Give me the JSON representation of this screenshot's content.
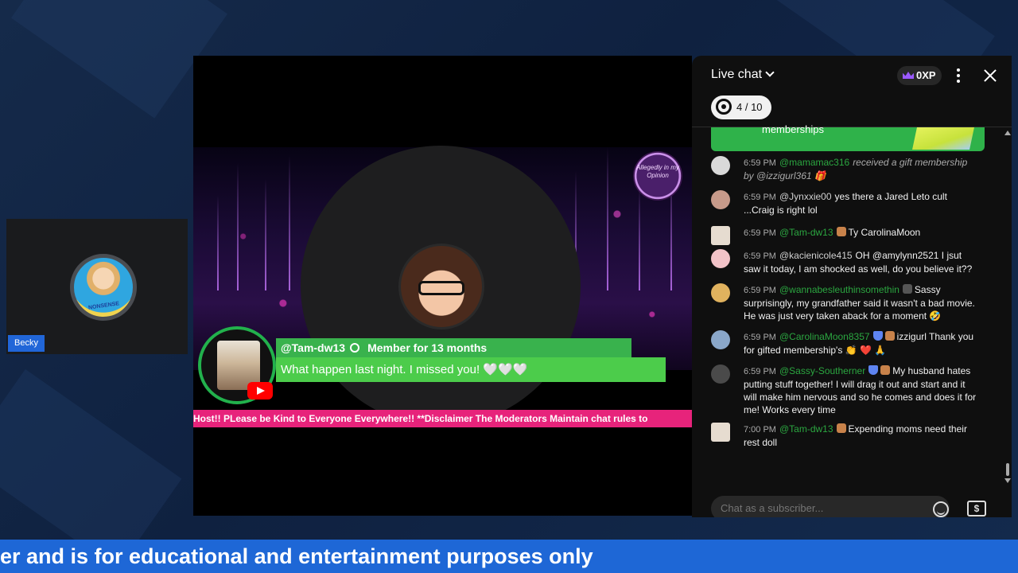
{
  "participant": {
    "name": "Becky",
    "avatar_text": "NONSENSE"
  },
  "stream": {
    "logo_text": "Allegedly in my Opinion",
    "highlight": {
      "author": "@Tam-dw13",
      "member_text": "Member for 13 months",
      "message": "What happen last night. I missed you! 🤍🤍🤍"
    },
    "ticker": "Host!! PLease be Kind to Everyone Everywhere!! **Disclaimer The Moderators Maintain chat rules to"
  },
  "chat": {
    "title": "Live chat",
    "xp": "0XP",
    "goal": "4 / 10",
    "gift_banner": "memberships",
    "input_placeholder": "Chat as a subscriber...",
    "messages": [
      {
        "time": "6:59 PM",
        "author": "@mamamac316",
        "text": "received a gift membership by @izzigurl361 🎁",
        "gift": true
      },
      {
        "time": "6:59 PM",
        "author": "@Jynxxie00",
        "text": "yes there a Jared Leto cult ...Craig is right lol"
      },
      {
        "time": "6:59 PM",
        "author": "@Tam-dw13",
        "text": "Ty CarolinaMoon",
        "member": true
      },
      {
        "time": "6:59 PM",
        "author": "@kacienicole415",
        "text": "OH @amylynn2521 I jsut saw it today, I am shocked as well, do you believe it??"
      },
      {
        "time": "6:59 PM",
        "author": "@wannabesleuthinsomethin",
        "text": "Sassy surprisingly, my grandfather said it wasn't a bad movie. He was just very taken aback for a moment 🤣",
        "member": true
      },
      {
        "time": "6:59 PM",
        "author": "@CarolinaMoon8357",
        "text": "izzigurl Thank you for gifted membership's 👏 ❤️ 🙏",
        "mod": true,
        "member": true
      },
      {
        "time": "6:59 PM",
        "author": "@Sassy-Southerner",
        "text": "My husband hates putting stuff together! I will drag it out and start and it will make him nervous and so he comes and does it for me! Works every time",
        "mod": true,
        "member": true
      },
      {
        "time": "7:00 PM",
        "author": "@Tam-dw13",
        "text": "Expending moms need their rest doll",
        "member": true
      }
    ]
  },
  "banner": "er and is for educational and entertainment purposes only",
  "colors": {
    "accent_green": "#39b24d",
    "ticker_pink": "#e7237b",
    "banner_blue": "#1e67d6"
  }
}
